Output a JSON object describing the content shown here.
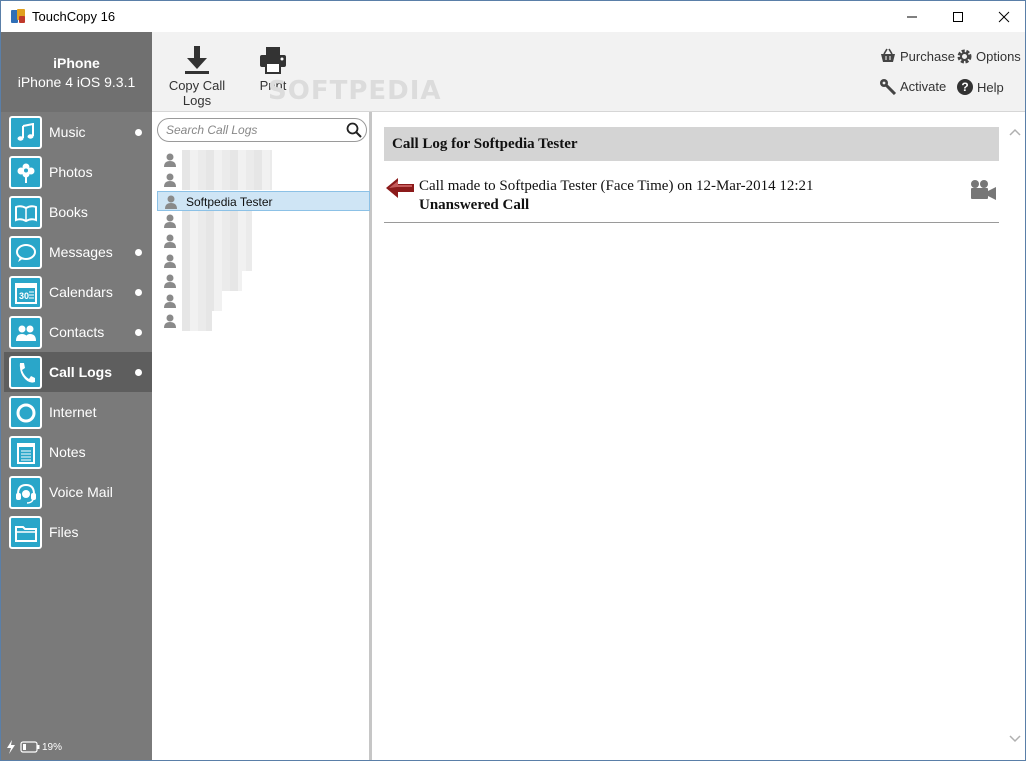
{
  "window": {
    "title": "TouchCopy 16"
  },
  "device": {
    "name": "iPhone",
    "model": "iPhone 4 iOS 9.3.1"
  },
  "toolbar": {
    "copy_label": "Copy Call Logs",
    "print_label": "Print",
    "watermark": "SOFTPEDIA",
    "purchase_label": "Purchase",
    "options_label": "Options",
    "activate_label": "Activate",
    "help_label": "Help"
  },
  "sidebar": {
    "items": [
      {
        "label": "Music",
        "icon": "music-note-icon",
        "dot": true
      },
      {
        "label": "Photos",
        "icon": "flower-icon",
        "dot": false
      },
      {
        "label": "Books",
        "icon": "book-icon",
        "dot": false
      },
      {
        "label": "Messages",
        "icon": "speech-bubble-icon",
        "dot": true
      },
      {
        "label": "Calendars",
        "icon": "calendar-icon",
        "dot": true
      },
      {
        "label": "Contacts",
        "icon": "people-icon",
        "dot": true
      },
      {
        "label": "Call Logs",
        "icon": "phone-icon",
        "dot": true,
        "active": true
      },
      {
        "label": "Internet",
        "icon": "globe-icon",
        "dot": false
      },
      {
        "label": "Notes",
        "icon": "notepad-icon",
        "dot": false
      },
      {
        "label": "Voice Mail",
        "icon": "voicemail-icon",
        "dot": false
      },
      {
        "label": "Files",
        "icon": "folder-icon",
        "dot": false
      }
    ],
    "battery": "19%"
  },
  "search": {
    "placeholder": "Search Call Logs"
  },
  "contacts": {
    "selected_name": "Softpedia Tester"
  },
  "detail": {
    "header": "Call Log for Softpedia Tester",
    "entry_text": "Call made to Softpedia Tester (Face Time) on 12-Mar-2014 12:21",
    "entry_status": "Unanswered Call"
  },
  "colors": {
    "accent": "#2aa6c9",
    "sidebar": "#7a7a7a",
    "selection": "#cfe5f5",
    "arrow": "#8b1a1a"
  }
}
